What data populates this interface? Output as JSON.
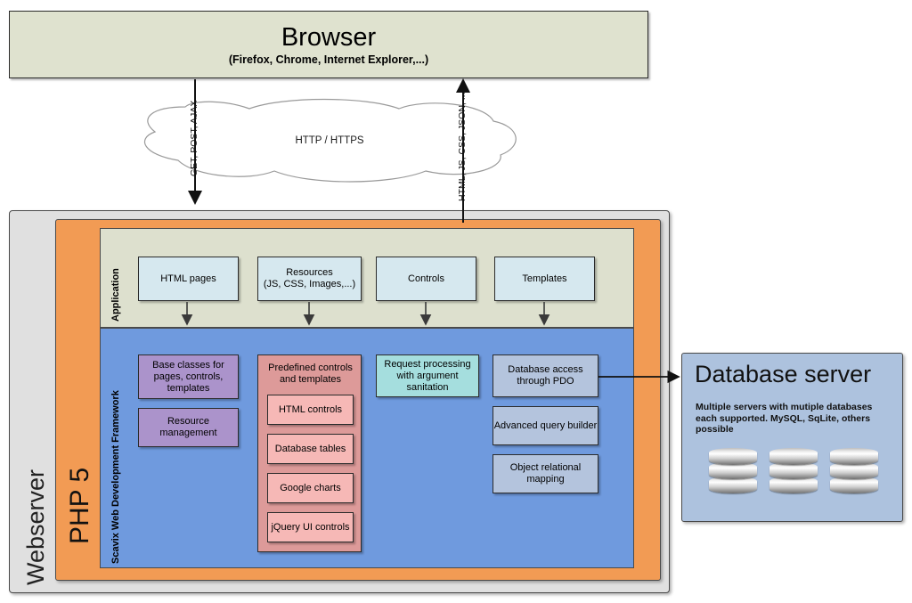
{
  "browser": {
    "title": "Browser",
    "subtitle": "(Firefox, Chrome, Internet Explorer,...)"
  },
  "network": {
    "cloud_label": "HTTP / HTTPS",
    "request_label": "GET, POST, AJAX",
    "response_label": "HTML, JS, CSS, JSON, ..."
  },
  "webserver": {
    "label": "Webserver",
    "php": {
      "label": "PHP 5",
      "application": {
        "label": "Application",
        "items": [
          {
            "label": "HTML pages"
          },
          {
            "label": "Resources",
            "label2": "(JS, CSS, Images,...)"
          },
          {
            "label": "Controls"
          },
          {
            "label": "Templates"
          }
        ]
      },
      "framework": {
        "label": "Scavix Web Development Framework",
        "base_classes": {
          "line1": "Base classes for",
          "line2": "pages, controls, templates"
        },
        "resource_management": {
          "label": "Resource management"
        },
        "predefined": {
          "title_line1": "Predefined controls",
          "title_line2": "and templates",
          "items": [
            {
              "label": "HTML controls"
            },
            {
              "label": "Database tables"
            },
            {
              "label": "Google charts"
            },
            {
              "label": "jQuery UI controls"
            }
          ]
        },
        "request_processing": {
          "line1": "Request processing",
          "line2": "with argument sanitation"
        },
        "data_items": [
          {
            "line1": "Database access",
            "line2": "through PDO"
          },
          {
            "line1": "Advanced query builder",
            "line2": ""
          },
          {
            "line1": "Object relational mapping",
            "line2": ""
          }
        ]
      }
    }
  },
  "database_server": {
    "title": "Database server",
    "description": "Multiple servers with mutiple databases each supported. MySQL, SqLite, others possible",
    "cylinder_count": 3
  },
  "colors": {
    "browser_fill": "#dfe2cf",
    "webserver_fill": "#e0e0e0",
    "php_fill": "#f29b54",
    "application_fill": "#dde0ce",
    "framework_fill": "#6f9ade",
    "app_item_fill": "#d6e8ef",
    "purple_fill": "#ab93cb",
    "teal_fill": "#a5dede",
    "predefined_fill": "#dd9a99",
    "predefined_item_fill": "#f6b8b6",
    "grayblue_fill": "#b4c4dd",
    "dbserver_fill": "#adc2de",
    "stroke": "#2b2b2b"
  }
}
